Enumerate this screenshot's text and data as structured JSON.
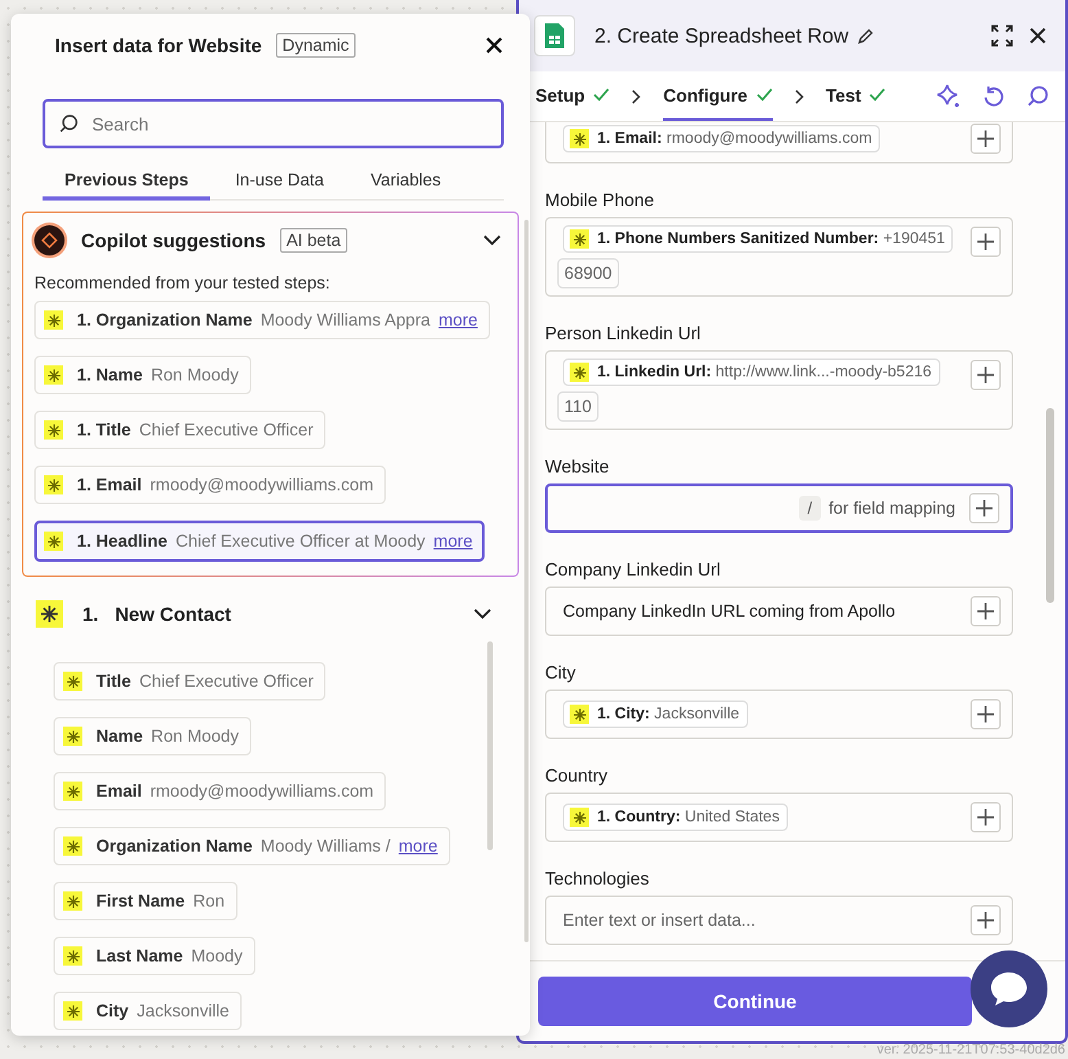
{
  "popover": {
    "title": "Insert data for Website",
    "badge": "Dynamic",
    "search": {
      "placeholder": "Search"
    },
    "tabs": [
      {
        "label": "Previous Steps",
        "selected": true
      },
      {
        "label": "In-use Data",
        "selected": false
      },
      {
        "label": "Variables",
        "selected": false
      }
    ],
    "copilot": {
      "title": "Copilot suggestions",
      "badge": "AI beta",
      "expanded": true,
      "intro": "Recommended from your tested steps:",
      "items": [
        {
          "key": "1. Organization Name",
          "value": "Moody Williams Appra",
          "more": "more",
          "selected": false
        },
        {
          "key": "1. Name",
          "value": "Ron Moody",
          "selected": false
        },
        {
          "key": "1. Title",
          "value": "Chief Executive Officer",
          "selected": false
        },
        {
          "key": "1. Email",
          "value": "rmoody@moodywilliams.com",
          "selected": false
        },
        {
          "key": "1. Headline",
          "value": "Chief Executive Officer at Moody",
          "more": "more",
          "selected": true
        }
      ]
    },
    "step": {
      "number": "1.",
      "title": "New Contact",
      "expanded": true,
      "items": [
        {
          "key": "Title",
          "value": "Chief Executive Officer"
        },
        {
          "key": "Name",
          "value": "Ron Moody"
        },
        {
          "key": "Email",
          "value": "rmoody@moodywilliams.com"
        },
        {
          "key": "Organization Name",
          "value": "Moody Williams /",
          "more": "more"
        },
        {
          "key": "First Name",
          "value": "Ron"
        },
        {
          "key": "Last Name",
          "value": "Moody"
        },
        {
          "key": "City",
          "value": "Jacksonville"
        }
      ]
    }
  },
  "panel": {
    "title": "2. Create Spreadsheet Row",
    "steps": [
      {
        "label": "Setup",
        "done": true,
        "selected": false
      },
      {
        "label": "Configure",
        "done": true,
        "selected": true
      },
      {
        "label": "Test",
        "done": true,
        "selected": false
      }
    ],
    "fields": [
      {
        "kind": "pills",
        "pills": [
          {
            "key": "1. Email:",
            "value": "rmoody@moodywilliams.com"
          }
        ]
      },
      {
        "kind": "pills",
        "label": "Mobile Phone",
        "pills": [
          {
            "key": "1. Phone Numbers Sanitized Number:",
            "value": "+190451"
          }
        ],
        "continuation": "68900"
      },
      {
        "kind": "pills",
        "label": "Person Linkedin Url",
        "pills": [
          {
            "key": "1. Linkedin Url:",
            "value": "http://www.link...-moody-b5216"
          }
        ],
        "continuation": "110"
      },
      {
        "kind": "focused",
        "label": "Website",
        "slash_key": "/",
        "hint": "for field mapping"
      },
      {
        "kind": "text",
        "label": "Company Linkedin Url",
        "value": "Company LinkedIn URL coming from Apollo"
      },
      {
        "kind": "pills",
        "label": "City",
        "pills": [
          {
            "key": "1. City:",
            "value": "Jacksonville"
          }
        ]
      },
      {
        "kind": "pills",
        "label": "Country",
        "pills": [
          {
            "key": "1. Country:",
            "value": "United States"
          }
        ]
      },
      {
        "kind": "empty",
        "label": "Technologies",
        "placeholder": "Enter text or insert data..."
      }
    ],
    "continue": "Continue"
  },
  "version": "ver. 2025-11-21T07:53-40d2d6"
}
